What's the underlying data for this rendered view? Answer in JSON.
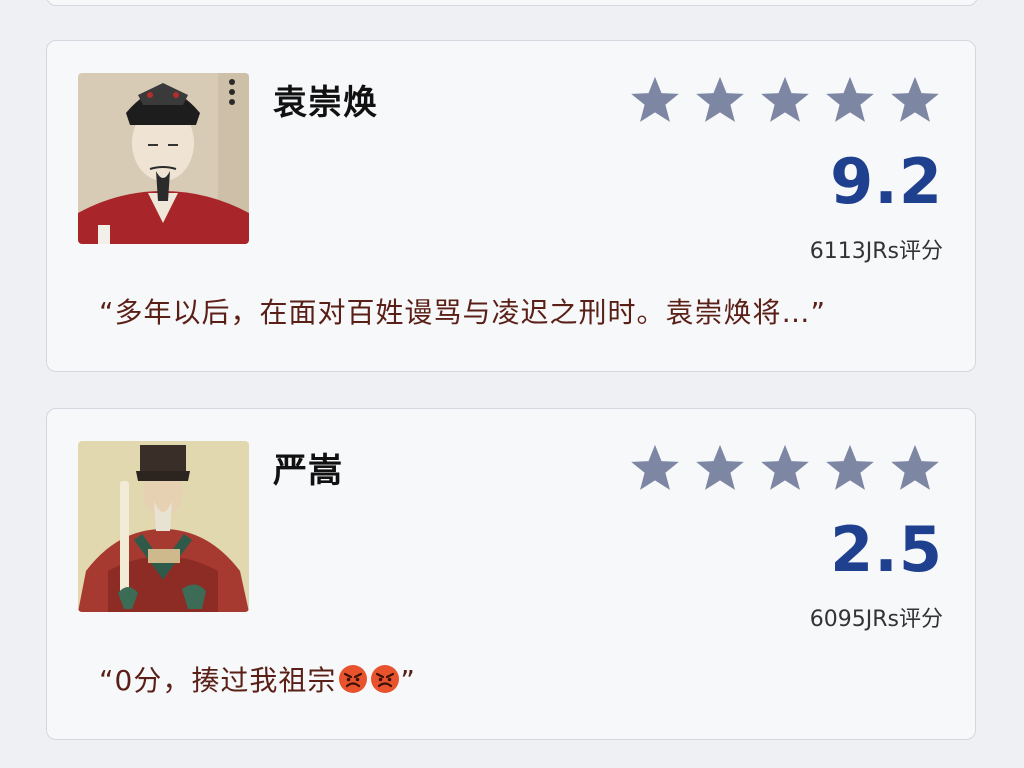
{
  "cards": [
    {
      "name": "袁崇焕",
      "stars": 5,
      "score": "9.2",
      "rating_count": "6113JRs评分",
      "quote": "“多年以后，在面对百姓谩骂与凌迟之刑时。袁崇焕将…”"
    },
    {
      "name": "严嵩",
      "stars": 5,
      "score": "2.5",
      "rating_count": "6095JRs评分",
      "quote": "“0分，揍过我祖宗",
      "quote_emojis": [
        "angry-face",
        "angry-face"
      ],
      "quote_end": "”"
    }
  ],
  "colors": {
    "star": "#7d87a4",
    "score": "#1f3f8f",
    "quote": "#5a1f16"
  }
}
